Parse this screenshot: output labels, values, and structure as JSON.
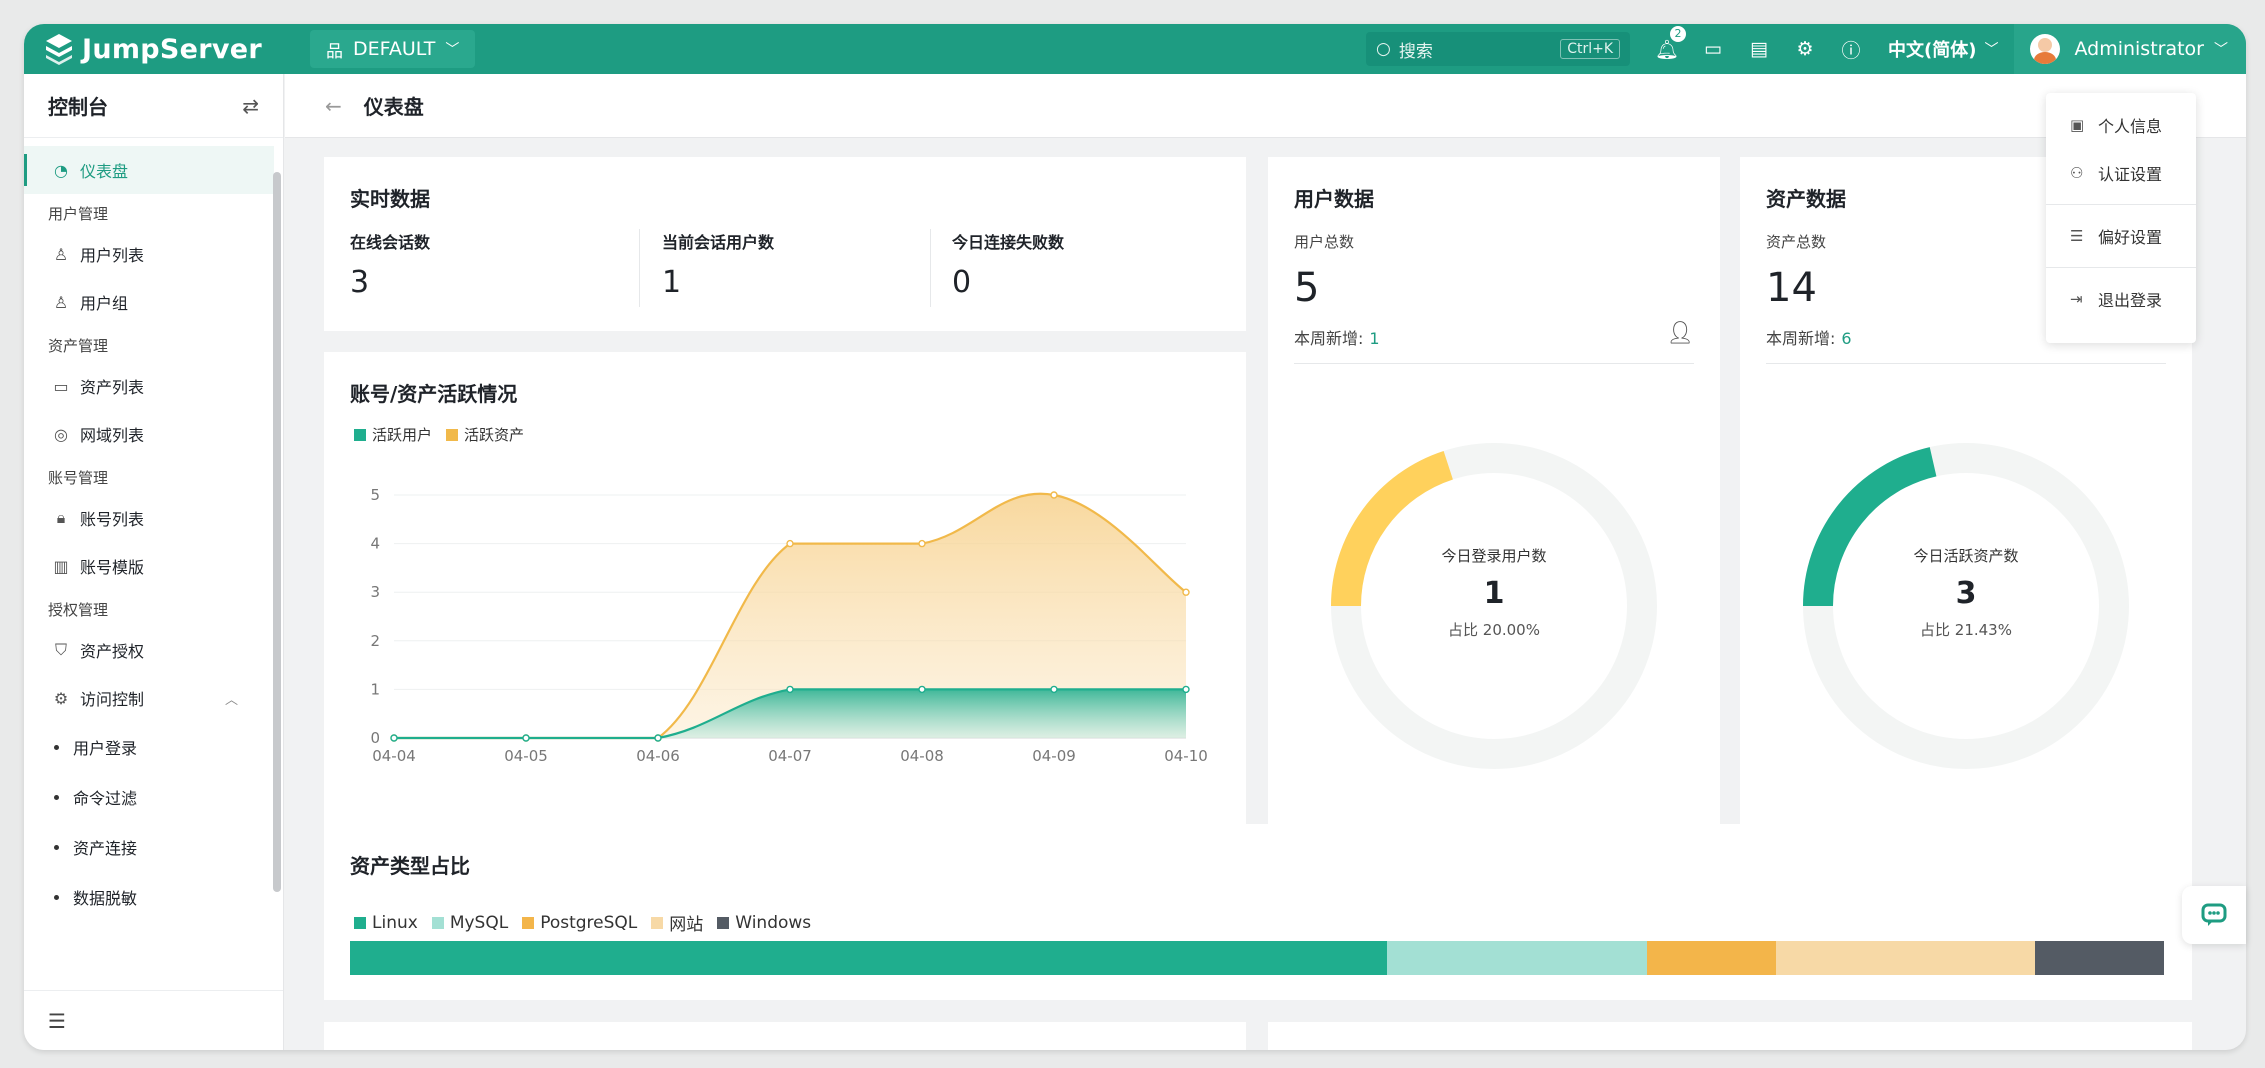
{
  "topbar": {
    "brand": "JumpServer",
    "org": "DEFAULT",
    "search_placeholder": "搜索",
    "search_shortcut": "Ctrl+K",
    "notification_count": "2",
    "language": "中文(简体)",
    "username": "Administrator"
  },
  "sidebar": {
    "title": "控制台",
    "items": [
      {
        "type": "item",
        "label": "仪表盘",
        "icon": "dashboard-icon",
        "active": true
      },
      {
        "type": "group",
        "label": "用户管理"
      },
      {
        "type": "item",
        "label": "用户列表",
        "icon": "user-icon"
      },
      {
        "type": "item",
        "label": "用户组",
        "icon": "user-group-icon"
      },
      {
        "type": "group",
        "label": "资产管理"
      },
      {
        "type": "item",
        "label": "资产列表",
        "icon": "monitor-icon"
      },
      {
        "type": "item",
        "label": "网域列表",
        "icon": "location-icon"
      },
      {
        "type": "group",
        "label": "账号管理"
      },
      {
        "type": "item",
        "label": "账号列表",
        "icon": "lock-icon"
      },
      {
        "type": "item",
        "label": "账号模版",
        "icon": "template-icon"
      },
      {
        "type": "group",
        "label": "授权管理"
      },
      {
        "type": "item",
        "label": "资产授权",
        "icon": "shield-icon"
      },
      {
        "type": "parent",
        "label": "访问控制",
        "icon": "access-control-icon"
      },
      {
        "type": "sub",
        "label": "用户登录"
      },
      {
        "type": "sub",
        "label": "命令过滤"
      },
      {
        "type": "sub",
        "label": "资产连接"
      },
      {
        "type": "sub",
        "label": "数据脱敏"
      }
    ]
  },
  "page": {
    "title": "仪表盘"
  },
  "realtime": {
    "title": "实时数据",
    "cells": [
      {
        "label": "在线会话数",
        "value": "3"
      },
      {
        "label": "当前会话用户数",
        "value": "1"
      },
      {
        "label": "今日连接失败数",
        "value": "0"
      }
    ]
  },
  "activity": {
    "title": "账号/资产活跃情况",
    "legend": [
      {
        "label": "活跃用户",
        "color": "#1fae8e"
      },
      {
        "label": "活跃资产",
        "color": "#f1b94a"
      }
    ]
  },
  "chart_data": {
    "type": "area",
    "x": [
      "04-04",
      "04-05",
      "04-06",
      "04-07",
      "04-08",
      "04-09",
      "04-10"
    ],
    "ylim": [
      0,
      5
    ],
    "yticks": [
      "0",
      "1",
      "2",
      "3",
      "4",
      "5"
    ],
    "series": [
      {
        "name": "活跃用户",
        "values": [
          0,
          0,
          0,
          1,
          1,
          1,
          1
        ],
        "color": "#1fae8e"
      },
      {
        "name": "活跃资产",
        "values": [
          0,
          0,
          0,
          4,
          4,
          5,
          3
        ],
        "color": "#f1b94a"
      }
    ]
  },
  "users": {
    "title": "用户数据",
    "total_label": "用户总数",
    "total": "5",
    "new_label": "本周新增:",
    "new_value": "1",
    "ring_label": "今日登录用户数",
    "ring_value": "1",
    "ring_percent": "占比 20.00%",
    "ring_fraction": 0.2,
    "ring_color": "#ffd15c"
  },
  "assets": {
    "title": "资产数据",
    "total_label": "资产总数",
    "total": "14",
    "new_label": "本周新增:",
    "new_value": "6",
    "ring_label": "今日活跃资产数",
    "ring_value": "3",
    "ring_percent": "占比 21.43%",
    "ring_fraction": 0.2143,
    "ring_color": "#1fae8e"
  },
  "asset_types": {
    "title": "资产类型占比",
    "items": [
      {
        "label": "Linux",
        "color": "#1fae8e",
        "share": 0.571
      },
      {
        "label": "MySQL",
        "color": "#a3e0d4",
        "share": 0.143
      },
      {
        "label": "PostgreSQL",
        "color": "#f3b54a",
        "share": 0.071
      },
      {
        "label": "网站",
        "color": "#f7d9a6",
        "share": 0.143
      },
      {
        "label": "Windows",
        "color": "#545b64",
        "share": 0.071
      }
    ]
  },
  "user_menu": {
    "items": [
      "个人信息",
      "认证设置",
      "偏好设置",
      "退出登录"
    ]
  }
}
